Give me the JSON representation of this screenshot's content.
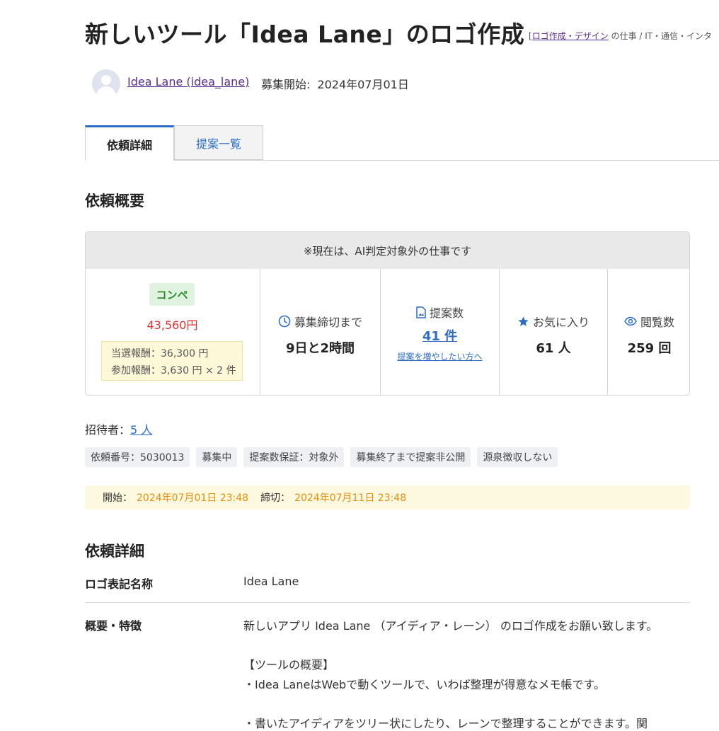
{
  "page": {
    "title": "新しいツール「Idea Lane」のロゴ作成",
    "category_prefix": "[",
    "category_link": "ロゴ作成・デザイン",
    "category_suffix": " の仕事 / IT・通信・インタ"
  },
  "client": {
    "name": "Idea Lane (idea_lane)",
    "start_label": "募集開始:",
    "start_date": "2024年07月01日"
  },
  "tabs": [
    {
      "label": "依頼詳細",
      "active": true
    },
    {
      "label": "提案一覧",
      "active": false
    }
  ],
  "overview": {
    "heading": "依頼概要",
    "notice": "※現在は、AI判定対象外の仕事です",
    "type_badge": "コンペ",
    "price": "43,560円",
    "reward_win": "当選報酬：36,300 円",
    "reward_participation": "参加報酬：3,630 円 × 2 件",
    "deadline_label": "募集締切まで",
    "deadline_value": "9日と2時間",
    "proposals_label": "提案数",
    "proposals_value": "41 件",
    "proposals_link": "提案を増やしたい方へ",
    "favorites_label": "お気に入り",
    "favorites_value": "61 人",
    "views_label": "閲覧数",
    "views_value": "259 回"
  },
  "invited": {
    "label": "招待者：",
    "value": "5 人"
  },
  "tags": [
    "依頼番号：5030013",
    "募集中",
    "提案数保証：対象外",
    "募集終了まで提案非公開",
    "源泉徴収しない"
  ],
  "period": {
    "start_label": "開始：",
    "start_value": "2024年07月01日 23:48",
    "end_label": "締切：",
    "end_value": "2024年07月11日 23:48"
  },
  "details": {
    "heading": "依頼詳細",
    "logo_name_label": "ロゴ表記名称",
    "logo_name_value": "Idea Lane",
    "summary_label": "概要・特徴",
    "summary_line1": "新しいアプリ Idea Lane （アイディア・レーン） のロゴ作成をお願い致します。",
    "summary_line2": "【ツールの概要】",
    "summary_line3": "・Idea LaneはWebで動くツールで、いわば整理が得意なメモ帳です。",
    "summary_line4": "・書いたアイディアをツリー状にしたり、レーンで整理することができます。関"
  },
  "colors": {
    "link": "#2c6cc7",
    "user_link": "#5a2d91",
    "price": "#e03030",
    "badge_green": "#2e8b2e",
    "date_orange": "#e8900c",
    "icon_blue": "#2c6cc7"
  }
}
